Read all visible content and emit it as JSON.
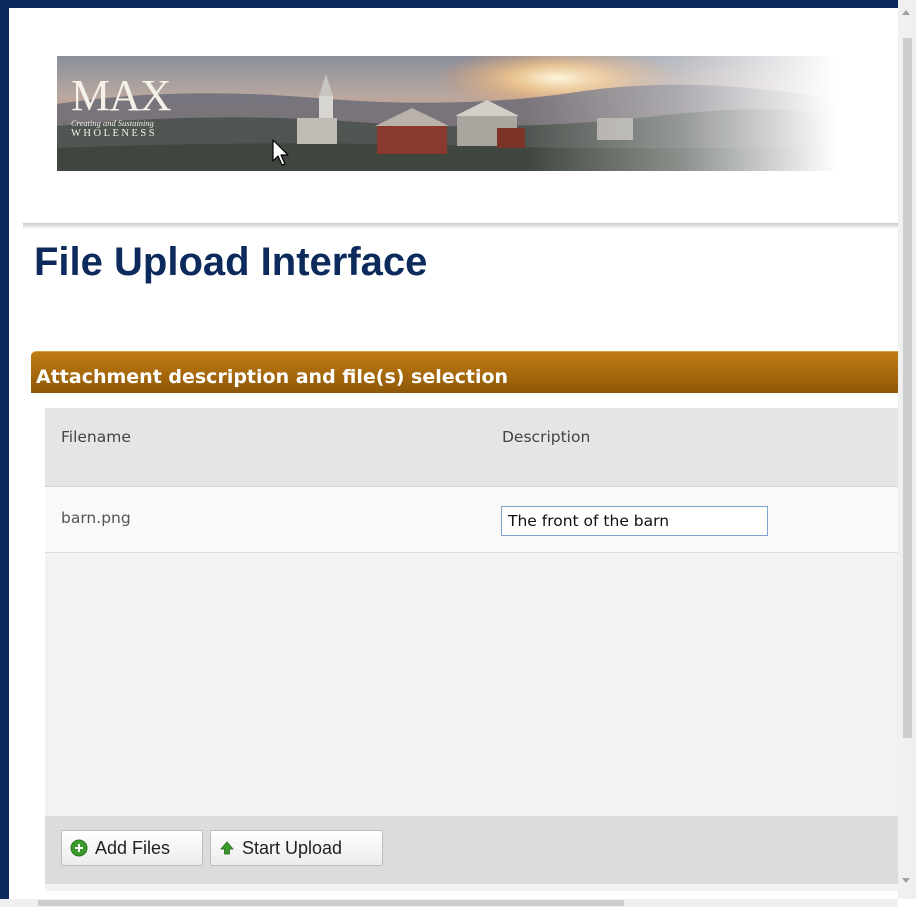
{
  "banner": {
    "logo_text": "MAX",
    "tagline": "Creating and Sustaining",
    "logo_subtext": "WHOLENESS"
  },
  "page": {
    "title": "File Upload Interface"
  },
  "panel": {
    "title": "Attachment description and file(s) selection",
    "columns": {
      "filename": "Filename",
      "description": "Description"
    },
    "rows": [
      {
        "filename": "barn.png",
        "description": "The front of the barn"
      }
    ]
  },
  "toolbar": {
    "add_files_label": "Add Files",
    "start_upload_label": "Start Upload"
  },
  "icons": {
    "add": "plus-circle-icon",
    "upload": "arrow-up-icon",
    "cursor": "mouse-pointer-icon"
  },
  "colors": {
    "frame": "#0a2a5c",
    "title": "#0c2a5c",
    "panel_header": "#a86a0c",
    "add_icon": "#3a9a2a",
    "upload_icon": "#3a9a2a"
  }
}
